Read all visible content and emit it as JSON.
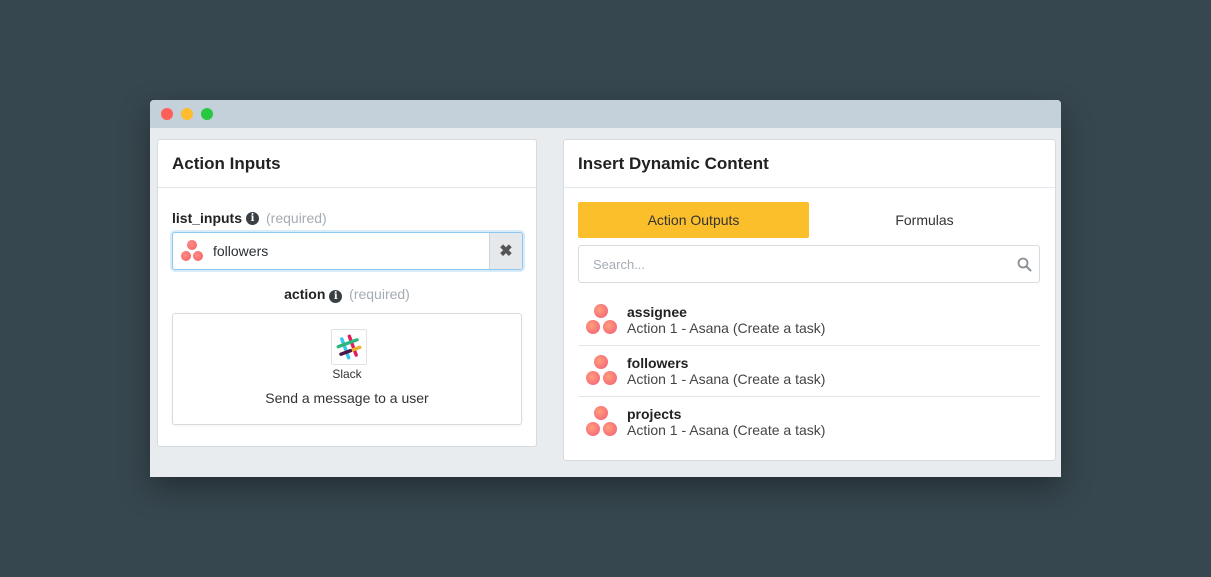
{
  "window": {
    "controls": [
      "close",
      "minimize",
      "maximize"
    ]
  },
  "left_panel": {
    "title": "Action Inputs",
    "list_inputs": {
      "label": "list_inputs",
      "required": "(required)",
      "value": "followers",
      "icon": "asana-icon",
      "clear_icon": "✖"
    },
    "action": {
      "label": "action",
      "required": "(required)",
      "app_name": "Slack",
      "description": "Send a message to a user"
    }
  },
  "right_panel": {
    "title": "Insert Dynamic Content",
    "tabs": [
      {
        "label": "Action Outputs",
        "active": true
      },
      {
        "label": "Formulas",
        "active": false
      }
    ],
    "search": {
      "placeholder": "Search..."
    },
    "items": [
      {
        "name": "assignee",
        "source": "Action 1 - Asana (Create a task)"
      },
      {
        "name": "followers",
        "source": "Action 1 - Asana (Create a task)"
      },
      {
        "name": "projects",
        "source": "Action 1 - Asana (Create a task)"
      }
    ]
  },
  "colors": {
    "background": "#37474f",
    "active_tab": "#fbbf2b",
    "asana": "#f25f5c",
    "input_focus": "#8ec7ef"
  }
}
